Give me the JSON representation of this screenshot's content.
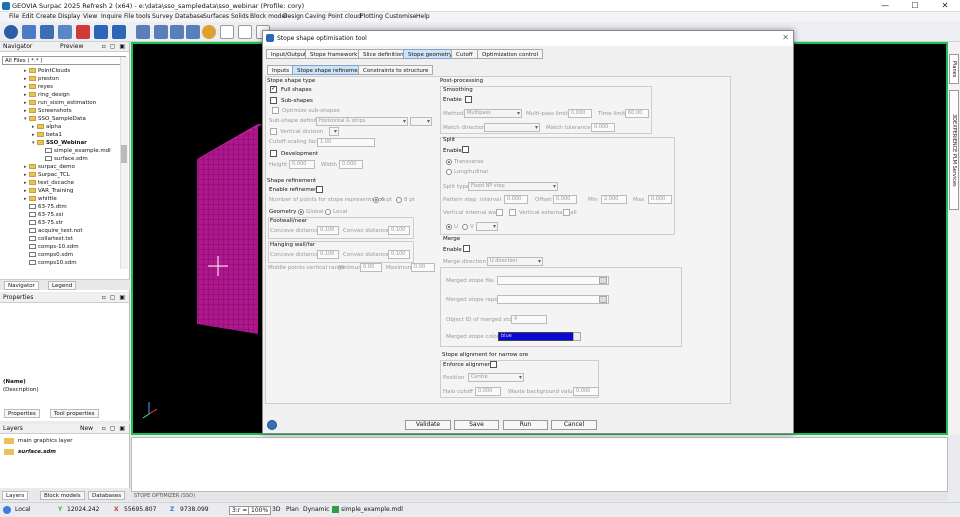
{
  "window": {
    "title": "GEOVIA Surpac 2025 Refresh 2 (x64) - e:\\data\\sso_sampledata\\sso_webinar (Profile: cory)",
    "controls": [
      "—",
      "☐",
      "✕"
    ]
  },
  "menu": [
    "File",
    "Edit",
    "Create",
    "Display",
    "View",
    "Inquire",
    "File tools",
    "Survey",
    "Database",
    "Surfaces",
    "Solids",
    "Block model",
    "Design",
    "Caving",
    "Point cloud",
    "Plotting",
    "Customise",
    "Help"
  ],
  "navigator": {
    "title": "Navigator",
    "preview_label": "Preview",
    "filter": "All Files ( *.* )",
    "tree": [
      {
        "label": "PointClouds",
        "type": "folder",
        "depth": 1,
        "expander": "▸"
      },
      {
        "label": "preston",
        "type": "folder",
        "depth": 1,
        "expander": "▸"
      },
      {
        "label": "reyes",
        "type": "folder",
        "depth": 1,
        "expander": "▸"
      },
      {
        "label": "ring_design",
        "type": "folder",
        "depth": 1,
        "expander": "▸"
      },
      {
        "label": "run_sisim_estimation",
        "type": "folder",
        "depth": 1,
        "expander": "▸"
      },
      {
        "label": "Screenshots",
        "type": "folder",
        "depth": 1,
        "expander": "▸"
      },
      {
        "label": "SSO_SampleData",
        "type": "folder",
        "depth": 1,
        "expander": "▾"
      },
      {
        "label": "alpha",
        "type": "folder",
        "depth": 2,
        "expander": "▸"
      },
      {
        "label": "beta1",
        "type": "folder",
        "depth": 2,
        "expander": "▸"
      },
      {
        "label": "SSO_Webinar",
        "type": "folder",
        "depth": 2,
        "expander": "▾",
        "bold": true
      },
      {
        "label": "simple_example.mdl",
        "type": "file",
        "depth": 3,
        "expander": ""
      },
      {
        "label": "surface.sdm",
        "type": "file",
        "depth": 3,
        "expander": ""
      },
      {
        "label": "surpac_demo",
        "type": "folder",
        "depth": 1,
        "expander": "▸"
      },
      {
        "label": "Surpac_TCL",
        "type": "folder",
        "depth": 1,
        "expander": "▸"
      },
      {
        "label": "test_dscache",
        "type": "folder",
        "depth": 1,
        "expander": "▸"
      },
      {
        "label": "VAR_Training",
        "type": "folder",
        "depth": 1,
        "expander": "▸"
      },
      {
        "label": "whittle",
        "type": "folder",
        "depth": 1,
        "expander": "▸"
      },
      {
        "label": "63-75.dtm",
        "type": "file",
        "depth": 1,
        "expander": ""
      },
      {
        "label": "63-75.ssi",
        "type": "file",
        "depth": 1,
        "expander": ""
      },
      {
        "label": "63-75.str",
        "type": "file",
        "depth": 1,
        "expander": ""
      },
      {
        "label": "acquire_test.not",
        "type": "file",
        "depth": 1,
        "expander": ""
      },
      {
        "label": "collartest.txt",
        "type": "file",
        "depth": 1,
        "expander": ""
      },
      {
        "label": "comps-10.sdm",
        "type": "file",
        "depth": 1,
        "expander": ""
      },
      {
        "label": "comps0.sdm",
        "type": "file",
        "depth": 1,
        "expander": ""
      },
      {
        "label": "comps10.sdm",
        "type": "file",
        "depth": 1,
        "expander": ""
      }
    ],
    "tabs": [
      "Navigator",
      "Legend"
    ]
  },
  "properties": {
    "title": "Properties",
    "name_label": "(Name)",
    "desc_label": "(Description)",
    "tabs": [
      "Properties",
      "Tool properties"
    ]
  },
  "layers": {
    "title": "Layers",
    "new_label": "New",
    "items": [
      "main graphics layer",
      "surface.sdm"
    ]
  },
  "bottom_tabs": [
    "Layers",
    "Block models",
    "Databases"
  ],
  "right_dock": [
    "Planes",
    "3DEXPERIENCE PLM Services"
  ],
  "message_bar": "STOPE OPTIMIZER (SSO)",
  "status": {
    "mode": "Local",
    "x": "12024.242",
    "y": "55695.807",
    "z": "9738.099",
    "zoom": "100%",
    "ratio": "3:r = 1",
    "view_3d": "3D",
    "view_plan": "Plan",
    "dynamic": "Dynamic",
    "file": "simple_example.mdl"
  },
  "dialog": {
    "title": "Stope shape optimisation tool",
    "tabs_top": [
      "Input/Output",
      "Stope framework",
      "Slice definition",
      "Stope geometry",
      "Cutoff",
      "Optimization control"
    ],
    "tabs_sub": [
      "Inputs",
      "Stope shape refinement",
      "Constraints to structure"
    ],
    "left": {
      "stope_shape_type": "Stope shape type",
      "full_shapes": "Full shapes",
      "sub_shapes": "Sub-shapes",
      "optimize_sub_shapes": "Optimize sub-shapes",
      "sub_shape_definition": "Sub-shape definition",
      "sub_shape_value": "Horizontal & strips",
      "vertical_division": "Vertical division",
      "cutoff_scaling_factor": "Cutoff scaling factor",
      "cutoff_scaling_value": "1.00",
      "development": "Development",
      "height": "Height",
      "height_value": "0.000",
      "width": "Width",
      "width_value": "0.000",
      "shape_refinement": "Shape refinement",
      "enable_refinement": "Enable refinement",
      "num_points": "Number of points for stope representation",
      "pt6": "6 pt",
      "pt8": "8 pt",
      "geometry": "Geometry",
      "global": "Global",
      "local": "Local",
      "footwall": "Footwall/near",
      "concave_distance": "Concave distance",
      "concave_value": "0.100",
      "convex_distance": "Convex distance",
      "convex_value": "0.100",
      "hanging_wall": "Hanging wall/far",
      "hw_concave_value": "0.100",
      "hw_convex_value": "0.100",
      "middle_points": "Middle points vertical range",
      "minimum": "Minimum",
      "minimum_value": "0.00",
      "maximum": "Maximum",
      "maximum_value": "0.00"
    },
    "right": {
      "post_processing": "Post-processing",
      "smoothing": "Smoothing",
      "enable": "Enable",
      "method": "Method",
      "method_value": "Multipass",
      "multi_pass_limit": "Multi-pass limit",
      "multi_pass_value": "0.000",
      "time_limit": "Time limit",
      "time_limit_value": "60.00",
      "match_direction": "Match direction",
      "match_tolerance": "Match tolerance",
      "match_tolerance_value": "0.000",
      "split": "Split",
      "transverse": "Transverse",
      "longitudinal": "Longitudinal",
      "split_type": "Split type",
      "split_type_value": "Fixed NP step",
      "pattern_step": "Pattern step",
      "interval": "Interval",
      "interval_value": "0.000",
      "offset": "Offset",
      "offset_value": "0.000",
      "min": "Min",
      "min_value": "2.000",
      "max": "Max",
      "max_value": "0.000",
      "vertical_internal_wall": "Vertical internal wall",
      "vertical_external_wall": "Vertical external wall",
      "u": "U",
      "v": "V",
      "merge": "Merge",
      "merge_direction": "Merge direction",
      "merge_direction_value": "U direction",
      "merged_stope_file": "Merged stope file",
      "merged_stope_report": "Merged stope report",
      "object_id": "Object ID of merged stope",
      "object_id_value": "4",
      "merged_stope_colour": "Merged stope colour",
      "merged_stope_colour_value": "blue",
      "alignment": "Stope alignment for narrow ore",
      "enforce_alignment": "Enforce alignment",
      "position": "Position",
      "position_value": "Centre",
      "halo_cutoff": "Halo cutoff",
      "halo_value": "0.000",
      "waste_background": "Waste background value",
      "waste_value": "0.000"
    },
    "buttons": [
      "Validate",
      "Save",
      "Run",
      "Cancel"
    ]
  },
  "colors": {
    "viewport_border": "#17c34e",
    "block_model": "#b0178f",
    "merge_colour": "#0a0ad6",
    "tab_selected": "#cfe2f7"
  }
}
